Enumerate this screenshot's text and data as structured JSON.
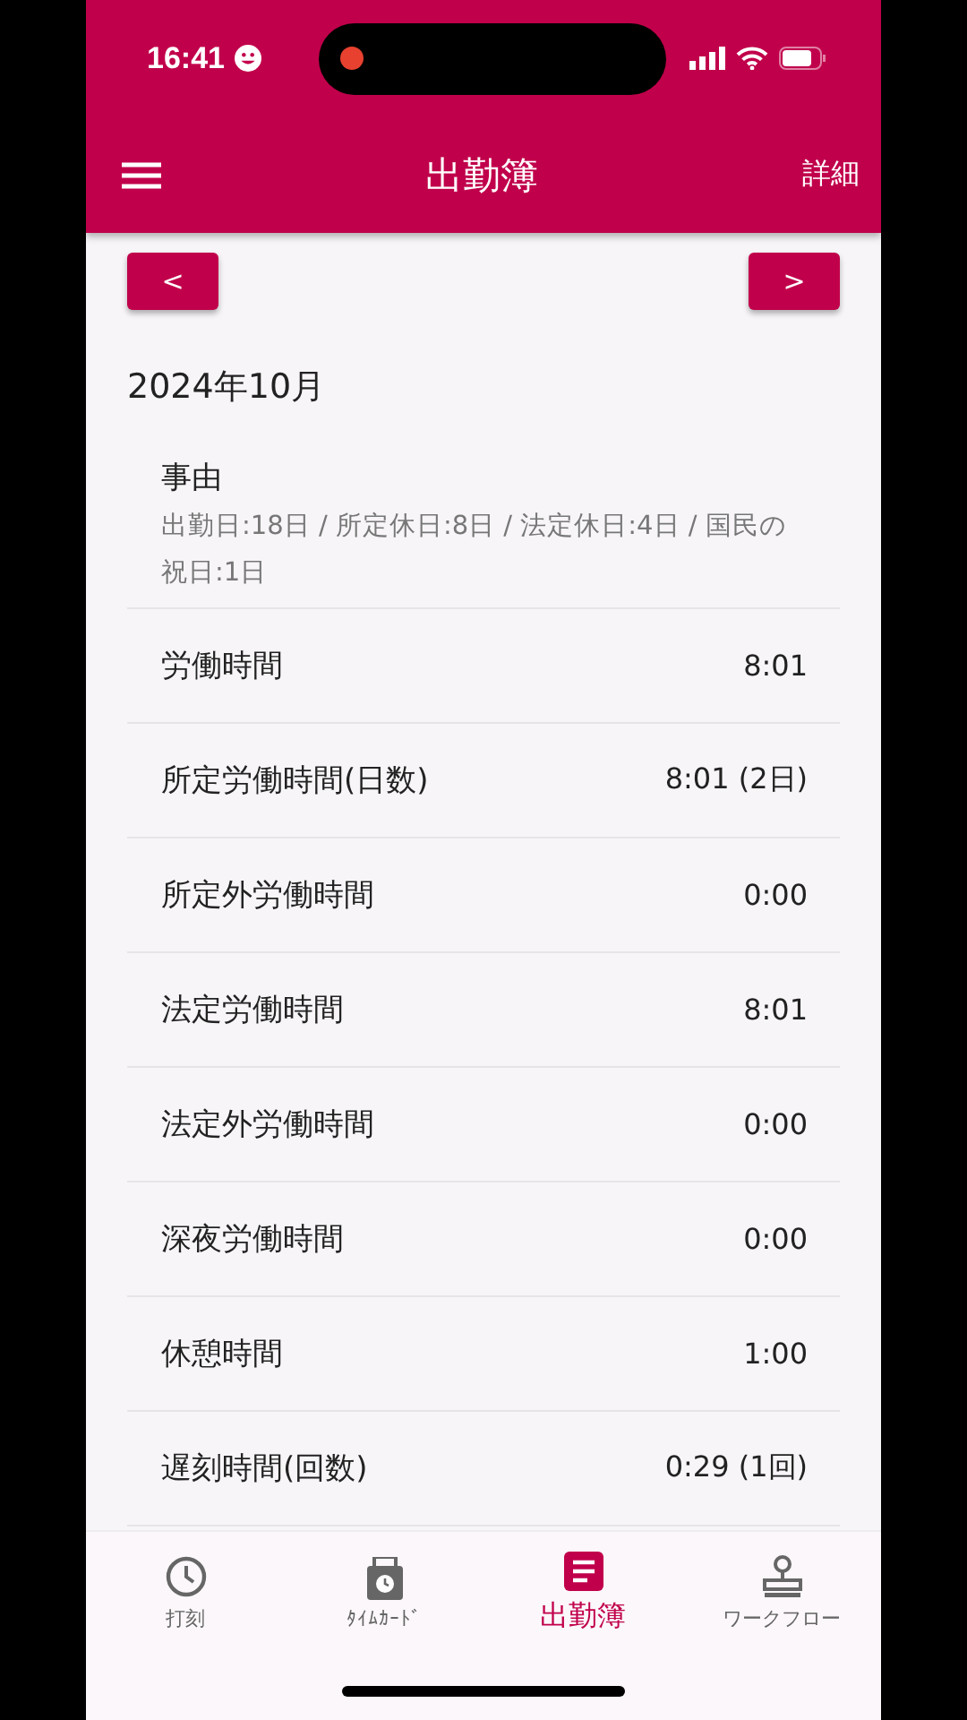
{
  "status_bar": {
    "time": "16:41"
  },
  "app_bar": {
    "title": "出勤簿",
    "action": "詳細"
  },
  "nav_buttons": {
    "prev": "<",
    "next": ">"
  },
  "month": "2024年10月",
  "reason": {
    "label": "事由",
    "detail": "出勤日:18日 / 所定休日:8日 / 法定休日:4日 / 国民の祝日:1日"
  },
  "rows": [
    {
      "label": "労働時間",
      "value": "8:01"
    },
    {
      "label": "所定労働時間(日数)",
      "value": "8:01 (2日)"
    },
    {
      "label": "所定外労働時間",
      "value": "0:00"
    },
    {
      "label": "法定労働時間",
      "value": "8:01"
    },
    {
      "label": "法定外労働時間",
      "value": "0:00"
    },
    {
      "label": "深夜労働時間",
      "value": "0:00"
    },
    {
      "label": "休憩時間",
      "value": "1:00"
    },
    {
      "label": "遅刻時間(回数)",
      "value": "0:29 (1回)"
    }
  ],
  "tabs": [
    {
      "kind": "clock",
      "label": "打刻",
      "selected": false
    },
    {
      "kind": "timecard",
      "label": "ﾀｲﾑｶｰﾄﾞ",
      "selected": false
    },
    {
      "kind": "book",
      "label": "出勤簿",
      "selected": true
    },
    {
      "kind": "stamp",
      "label": "ワークフロー",
      "selected": false
    }
  ]
}
